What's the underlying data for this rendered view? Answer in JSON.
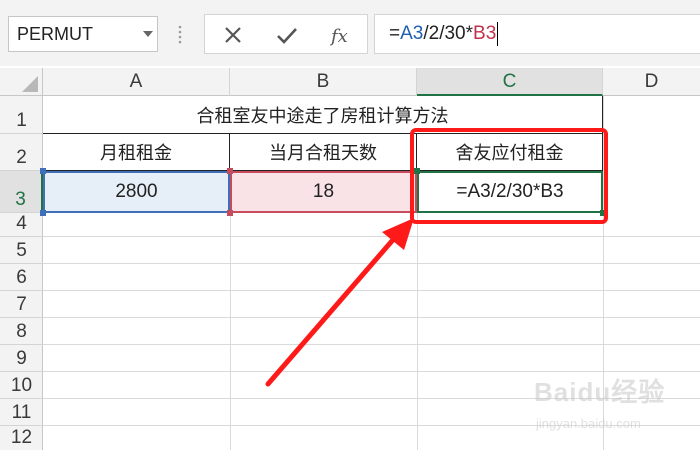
{
  "formula_bar": {
    "name_box": "PERMUT",
    "buttons": [
      {
        "name": "cancel",
        "icon": "x-icon"
      },
      {
        "name": "enter",
        "icon": "check-icon"
      },
      {
        "name": "insert-function",
        "icon": "fx-icon",
        "label": "fx"
      }
    ],
    "formula": {
      "prefix": "=",
      "ref1": "A3",
      "mid": "/2/30*",
      "ref2": "B3"
    }
  },
  "columns": [
    "A",
    "B",
    "C",
    "D"
  ],
  "active_column": "C",
  "rows": [
    "1",
    "2",
    "3",
    "4",
    "5",
    "6",
    "7",
    "8",
    "9",
    "10",
    "11",
    "12"
  ],
  "active_row": "3",
  "sheet": {
    "title": "合租室友中途走了房租计算方法",
    "headers": [
      "月租租金",
      "当月合租天数",
      "舍友应付租金"
    ],
    "values": [
      "2800",
      "18",
      "=A3/2/30*B3"
    ]
  },
  "colors": {
    "accent_green": "#217346",
    "ref_blue": "#3f6fb8",
    "ref_red": "#c64b5c",
    "annotation_red": "#ff1a1a"
  },
  "watermark": {
    "main": "Baidu经验",
    "sub": "jingyan.baidu.com"
  }
}
